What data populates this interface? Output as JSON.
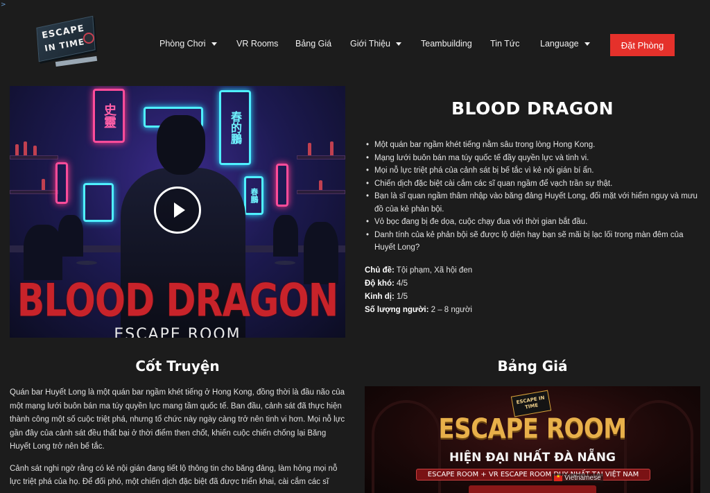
{
  "corner_mark": ">",
  "logo": {
    "line1": "ESCAPE",
    "line2": "IN TIME"
  },
  "nav": {
    "items": [
      {
        "label": "Phòng Chơi",
        "has_dropdown": true
      },
      {
        "label": "VR Rooms",
        "has_dropdown": false
      },
      {
        "label": "Bảng Giá",
        "has_dropdown": false
      },
      {
        "label": "Giới Thiệu",
        "has_dropdown": true
      },
      {
        "label": "Teambuilding",
        "has_dropdown": false
      },
      {
        "label": "Tin Tức",
        "has_dropdown": false
      },
      {
        "label": "Language",
        "has_dropdown": true
      }
    ],
    "book_button": "Đặt Phòng"
  },
  "hero": {
    "title": "BLOOD DRAGON",
    "subtitle": "ESCAPE ROOM",
    "neon_left": "史靈",
    "neon_right": "春的鵬",
    "neon_small": "春鵬"
  },
  "room": {
    "title": "BLOOD DRAGON",
    "bullets": [
      "Một quán bar ngầm khét tiếng nằm sâu trong lòng Hong Kong.",
      "Mạng lưới buôn bán ma túy quốc tế đầy quyền lực và tinh vi.",
      "Mọi nỗ lực triệt phá của cảnh sát bị bế tắc vì kẻ nội gián bí ẩn.",
      "Chiến dịch đặc biệt cài cắm các sĩ quan ngầm để vạch trần sự thật.",
      "Bạn là sĩ quan ngầm thâm nhập vào băng đảng Huyết Long, đối mặt với hiểm nguy và mưu đồ của kẻ phản bội.",
      "Vỏ bọc đang bị đe dọa, cuộc chạy đua với thời gian bắt đầu.",
      "Danh tính của kẻ phản bội sẽ được lộ diện hay bạn sẽ mãi bị lạc lối trong màn đêm của Huyết Long?"
    ],
    "facts": [
      {
        "label": "Chủ đề:",
        "value": " Tội phạm, Xã hội đen"
      },
      {
        "label": "Độ khó:",
        "value": " 4/5"
      },
      {
        "label": "Kinh dị:",
        "value": " 1/5"
      },
      {
        "label": "Số lượng người:",
        "value": " 2 – 8 người"
      }
    ]
  },
  "story": {
    "title": "Cốt Truyện",
    "paragraphs": [
      "Quán bar Huyết Long là một quán bar ngầm khét tiếng ở Hong Kong, đồng thời là đầu não của một mạng lưới buôn bán ma túy quyền lực mang tầm quốc tế. Ban đầu, cảnh sát đã thực hiện thành công một số cuộc triệt phá, nhưng tổ chức này ngày càng trở nên tinh vi hơn. Mọi nỗ lực gần đây của cảnh sát đều thất bại ở thời điểm then chốt, khiến cuộc chiến chống lại Băng Huyết Long trở nên bế tắc.",
      "Cảnh sát nghi ngờ rằng có kẻ nội gián đang tiết lộ thông tin cho băng đảng, làm hỏng mọi nỗ lực triệt phá của họ. Để đối phó, một chiến dịch đặc biệt đã được triển khai, cài cắm các sĩ quan"
    ]
  },
  "pricing": {
    "title": "Bảng Giá",
    "mini_logo": "ESCAPE IN TIME",
    "headline": "ESCAPE ROOM",
    "subline": "HIỆN ĐẠI NHẤT ĐÀ NẴNG",
    "band": "ESCAPE ROOM + VR ESCAPE ROOM DUY NHẤT TẠI VIỆT NAM"
  },
  "language_tag": "Vietnamese",
  "colors": {
    "accent": "#e5312b",
    "background": "#1c1c1c"
  }
}
